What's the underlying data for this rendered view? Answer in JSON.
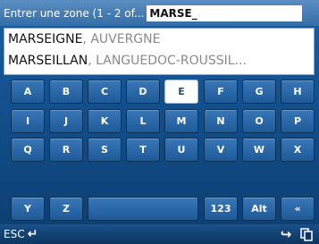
{
  "header": {
    "label": "Entrer une zone (1 - 2 of...",
    "search_value": "MARSE_"
  },
  "results": [
    {
      "name": "MARSEIGNE",
      "region": ", AUVERGNE"
    },
    {
      "name": "MARSEILLAN",
      "region": ", LANGUEDOC-ROUSSIL..."
    }
  ],
  "keyboard": {
    "rows": [
      [
        "A",
        "B",
        "C",
        "D",
        "E",
        "F",
        "G",
        "H"
      ],
      [
        "I",
        "J",
        "K",
        "L",
        "M",
        "N",
        "O",
        "P"
      ],
      [
        "Q",
        "R",
        "S",
        "T",
        "U",
        "V",
        "W",
        "X"
      ]
    ],
    "last_row": [
      "Y",
      "Z",
      "",
      "123",
      "Alt",
      "«"
    ],
    "selected_key": "E"
  },
  "footer": {
    "esc_label": "ESC",
    "esc_icon": "return-arrow-icon",
    "next_icon": "forward-arrow-icon",
    "copy_icon": "copy-icon"
  },
  "colors": {
    "background": "#124f8c",
    "header": "#4a80b8",
    "key": "#2a68a8",
    "selected_key": "#ffffff"
  }
}
